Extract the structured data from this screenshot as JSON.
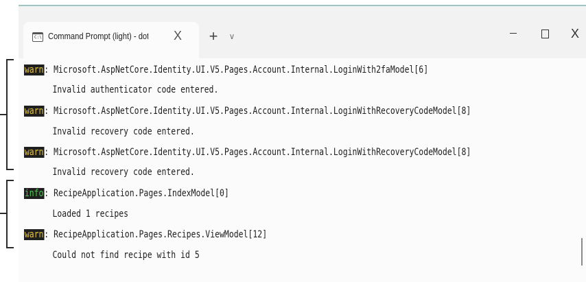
{
  "window": {
    "tab_title": "Command Prompt (light) - dot",
    "tab_icon_glyph": "C:\\",
    "tab_icon": "terminal-icon",
    "close_tab_glyph": "X",
    "new_tab_glyph": "+",
    "dropdown_glyph": "∨",
    "close_window_glyph": "X"
  },
  "log_entries": [
    {
      "level": "warn",
      "source": "Microsoft.AspNetCore.Identity.UI.V5.Pages.Account.Internal.LoginWith2faModel[6]",
      "message": "Invalid authenticator code entered."
    },
    {
      "level": "warn",
      "source": "Microsoft.AspNetCore.Identity.UI.V5.Pages.Account.Internal.LoginWithRecoveryCodeModel[8]",
      "message": "Invalid recovery code entered."
    },
    {
      "level": "warn",
      "source": "Microsoft.AspNetCore.Identity.UI.V5.Pages.Account.Internal.LoginWithRecoveryCodeModel[8]",
      "message": "Invalid recovery code entered."
    },
    {
      "level": "info",
      "source": "RecipeApplication.Pages.IndexModel[0]",
      "message": "Loaded 1 recipes"
    },
    {
      "level": "warn",
      "source": "RecipeApplication.Pages.Recipes.ViewModel[12]",
      "message": "Could not find recipe with id 5"
    }
  ],
  "colors": {
    "warn": "#e5c33a",
    "info": "#4cc94c",
    "badge_bg": "#1f1f1f",
    "accent": "#9ec7c2"
  }
}
